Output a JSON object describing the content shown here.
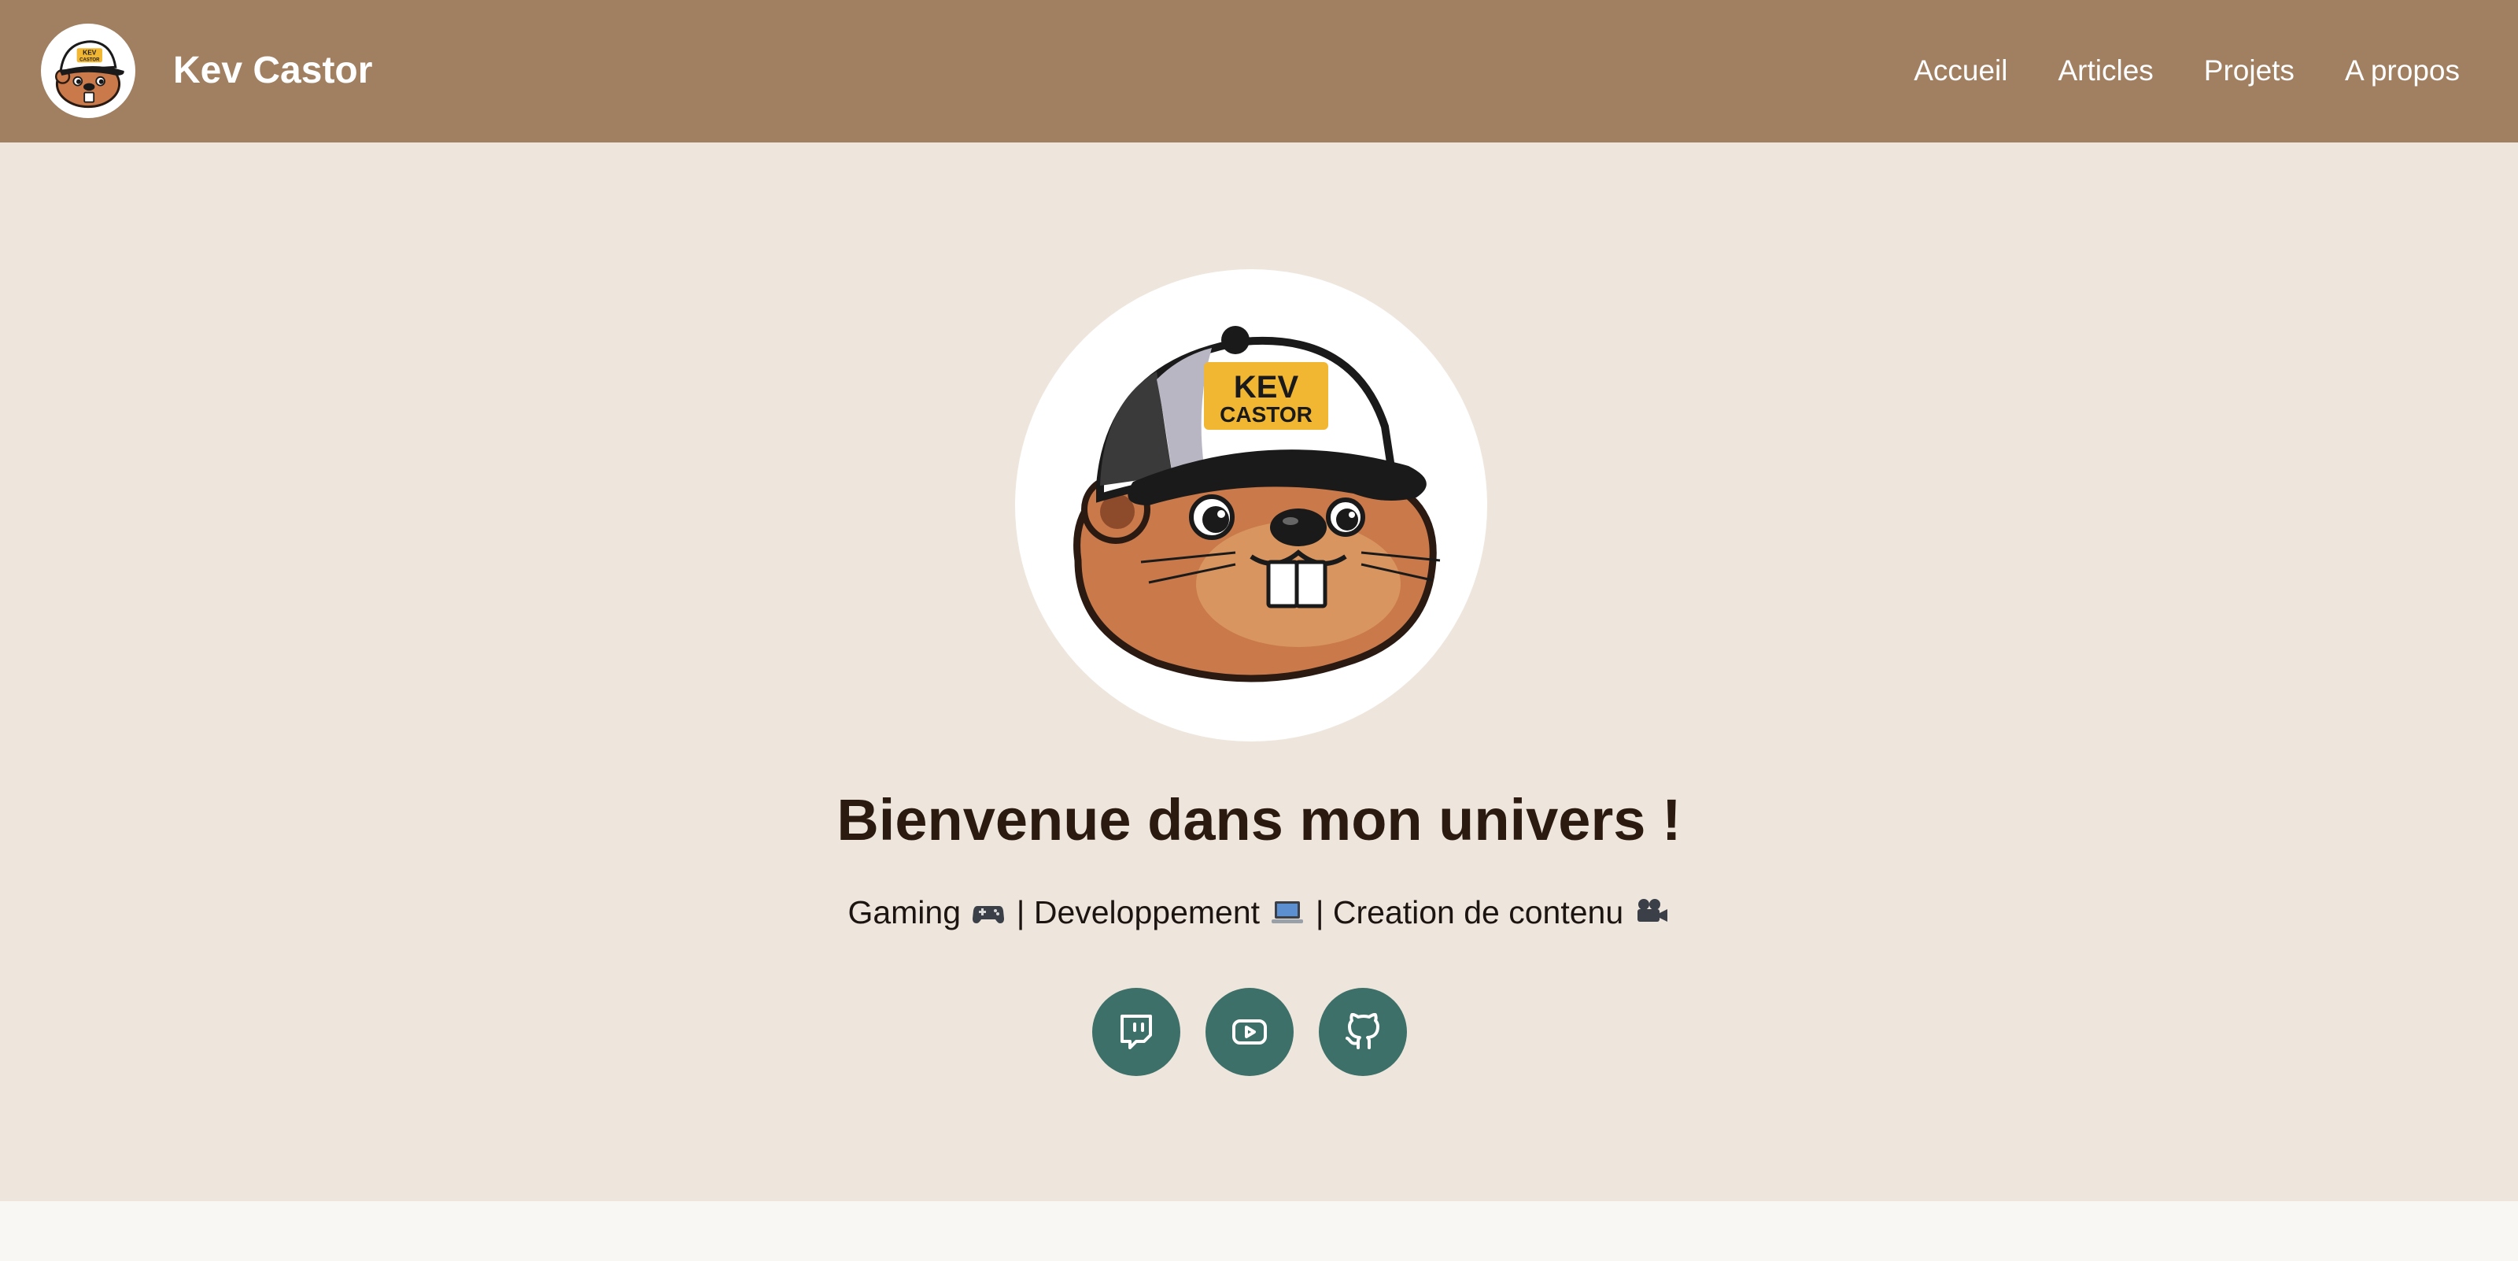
{
  "header": {
    "site_title": "Kev Castor",
    "logo_text_line1": "KEV",
    "logo_text_line2": "CASTOR",
    "nav": [
      {
        "label": "Accueil"
      },
      {
        "label": "Articles"
      },
      {
        "label": "Projets"
      },
      {
        "label": "A propos"
      }
    ]
  },
  "hero": {
    "avatar_text_line1": "KEV",
    "avatar_text_line2": "CASTOR",
    "title": "Bienvenue dans mon univers !",
    "tagline": {
      "part1": "Gaming",
      "sep1": " | ",
      "part2": "Developpement",
      "sep2": " | ",
      "part3": "Creation de contenu"
    },
    "socials": [
      {
        "icon": "twitch-icon"
      },
      {
        "icon": "youtube-icon"
      },
      {
        "icon": "github-icon"
      }
    ]
  },
  "colors": {
    "header_bg": "#a17f61",
    "hero_bg": "#eee6dc",
    "social_bg": "#3c7069",
    "title_color": "#2b1a10"
  }
}
